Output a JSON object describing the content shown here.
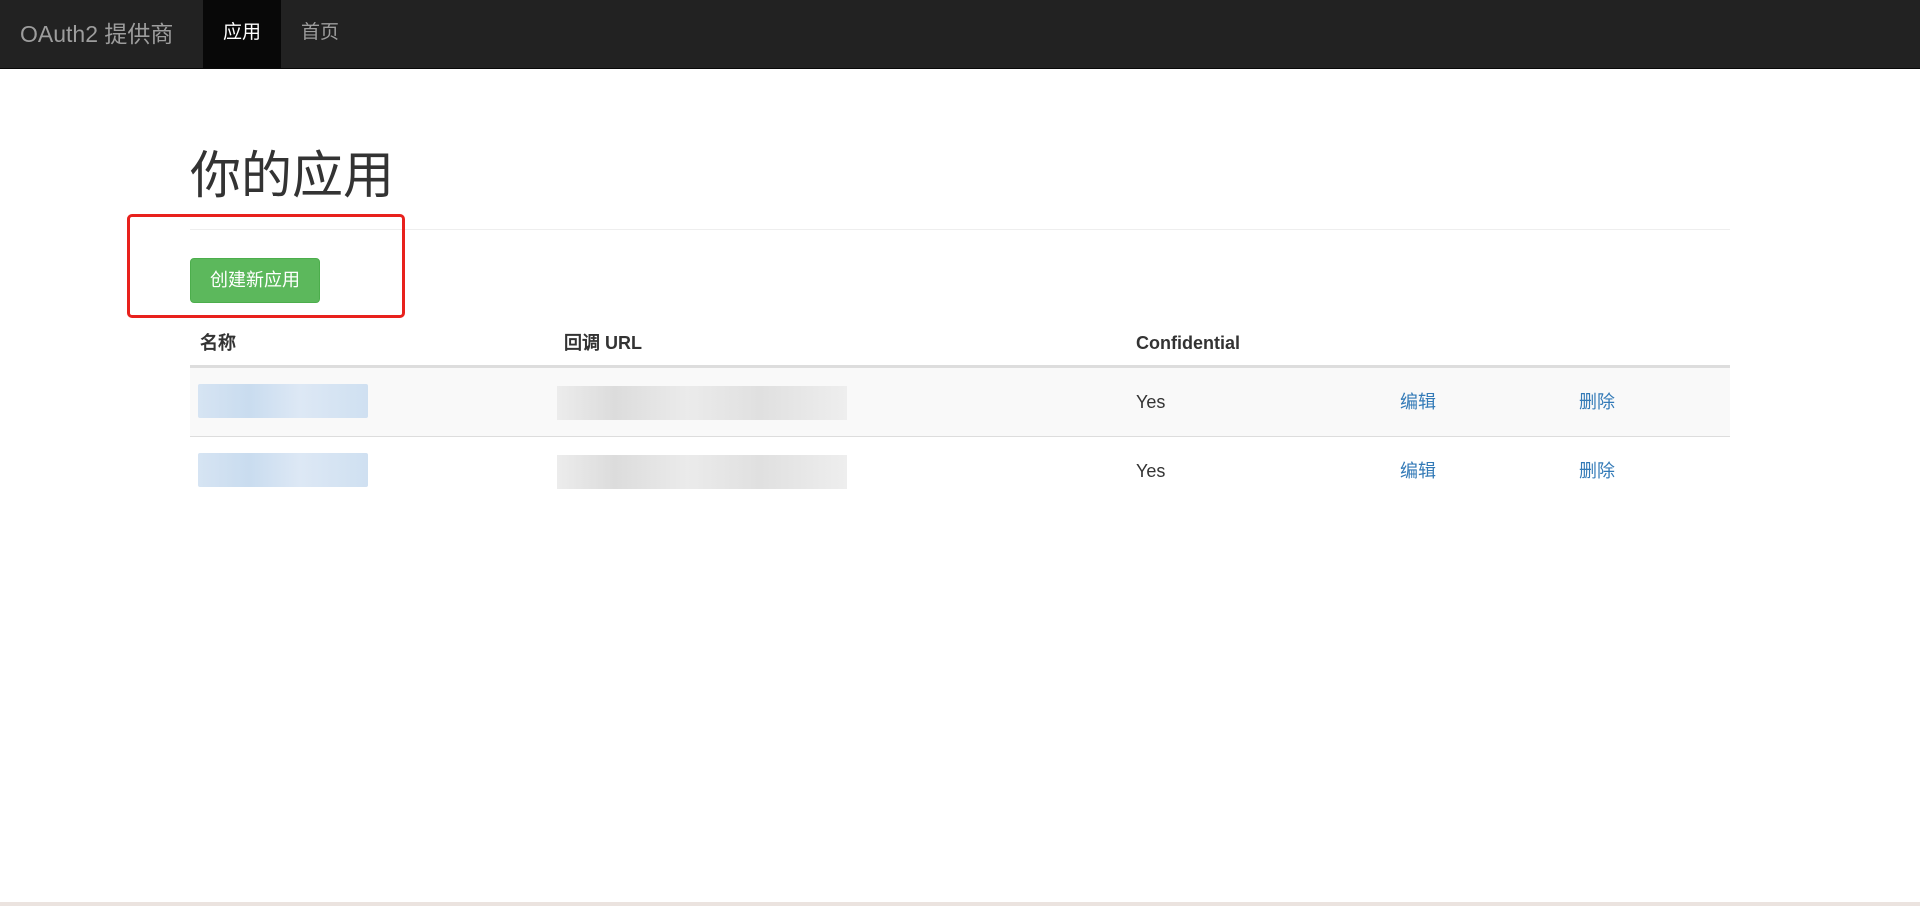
{
  "navbar": {
    "brand": "OAuth2 提供商",
    "items": [
      {
        "label": "应用",
        "active": true
      },
      {
        "label": "首页",
        "active": false
      }
    ]
  },
  "page": {
    "title": "你的应用",
    "create_button": "创建新应用"
  },
  "table": {
    "headers": [
      "名称",
      "回调 URL",
      "Confidential"
    ],
    "rows": [
      {
        "name": "",
        "callback_url": "",
        "confidential": "Yes",
        "edit": "编辑",
        "delete": "删除"
      },
      {
        "name": "",
        "callback_url": "",
        "confidential": "Yes",
        "edit": "编辑",
        "delete": "删除"
      }
    ]
  },
  "colors": {
    "navbar_bg": "#222222",
    "success": "#5cb85c",
    "link": "#337ab7",
    "highlight": "#e8211d"
  }
}
